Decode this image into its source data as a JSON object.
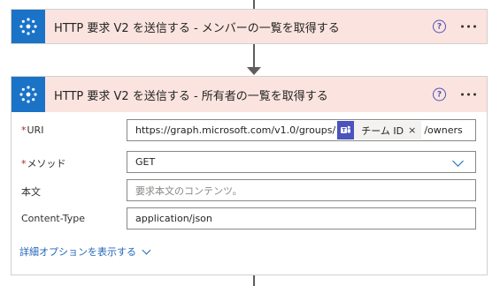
{
  "actions": [
    {
      "title": "HTTP 要求 V2 を送信する - メンバーの一覧を取得する",
      "help_icon": "question-circle-icon",
      "more_icon": "ellipsis-icon",
      "app_icon": "graph-connector-icon"
    },
    {
      "title": "HTTP 要求 V2 を送信する - 所有者の一覧を取得する",
      "help_icon": "question-circle-icon",
      "more_icon": "ellipsis-icon",
      "app_icon": "graph-connector-icon",
      "fields": {
        "uri": {
          "required_mark": "*",
          "label": "URI",
          "value_prefix": "https://graph.microsoft.com/v1.0/groups/",
          "token": {
            "label": "チーム ID",
            "close": "×",
            "icon": "teams-icon"
          },
          "value_suffix": "/owners"
        },
        "method": {
          "required_mark": "*",
          "label": "メソッド",
          "value": "GET",
          "dropdown_icon": "chevron-down-icon"
        },
        "body": {
          "label": "本文",
          "placeholder": "要求本文のコンテンツ。"
        },
        "content_type": {
          "label": "Content-Type",
          "value": "application/json"
        }
      },
      "advanced_link": "詳細オプションを表示する"
    }
  ],
  "colors": {
    "header_bg": "#fbe4df",
    "app_icon_bg": "#1a73c7",
    "accent": "#0f6cbd",
    "required": "#a4262c",
    "teams": "#4b53bc",
    "link": "#2266b8"
  }
}
